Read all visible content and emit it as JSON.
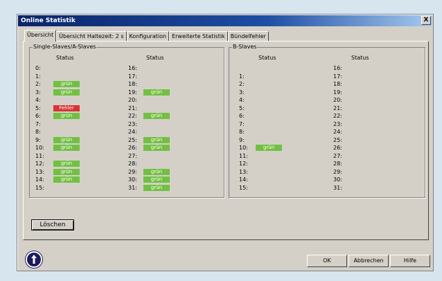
{
  "window": {
    "title": "Online Statistik",
    "close_label": "X"
  },
  "tabs": [
    "Übersicht",
    "Übersicht  Haltezeit: 2 s",
    "Konfiguration",
    "Erweiterte Statistik",
    "Bündelfehler"
  ],
  "single_group": {
    "title": "Single-Slaves/A-Slaves",
    "status_header": "Status",
    "left": [
      {
        "num": "0:",
        "status": ""
      },
      {
        "num": "1:",
        "status": ""
      },
      {
        "num": "2:",
        "status": "grün"
      },
      {
        "num": "3:",
        "status": "grün"
      },
      {
        "num": "4:",
        "status": ""
      },
      {
        "num": "5:",
        "status": "Fehler"
      },
      {
        "num": "6:",
        "status": "grün"
      },
      {
        "num": "7:",
        "status": ""
      },
      {
        "num": "8:",
        "status": ""
      },
      {
        "num": "9:",
        "status": "grün"
      },
      {
        "num": "10:",
        "status": "grün"
      },
      {
        "num": "11:",
        "status": ""
      },
      {
        "num": "12:",
        "status": "grün"
      },
      {
        "num": "13:",
        "status": "grün"
      },
      {
        "num": "14:",
        "status": "grün"
      },
      {
        "num": "15:",
        "status": ""
      }
    ],
    "right": [
      {
        "num": "16:",
        "status": ""
      },
      {
        "num": "17:",
        "status": ""
      },
      {
        "num": "18:",
        "status": ""
      },
      {
        "num": "19:",
        "status": "grün"
      },
      {
        "num": "20:",
        "status": ""
      },
      {
        "num": "21:",
        "status": ""
      },
      {
        "num": "22:",
        "status": "grün"
      },
      {
        "num": "23:",
        "status": ""
      },
      {
        "num": "24:",
        "status": ""
      },
      {
        "num": "25:",
        "status": "grün"
      },
      {
        "num": "26:",
        "status": "grün"
      },
      {
        "num": "27:",
        "status": ""
      },
      {
        "num": "28:",
        "status": ""
      },
      {
        "num": "29:",
        "status": "grün"
      },
      {
        "num": "30:",
        "status": "grün"
      },
      {
        "num": "31:",
        "status": "grün"
      }
    ]
  },
  "b_group": {
    "title": "B-Slaves",
    "status_header": "Status",
    "left": [
      {
        "num": "",
        "status": ""
      },
      {
        "num": "1:",
        "status": ""
      },
      {
        "num": "2:",
        "status": ""
      },
      {
        "num": "3:",
        "status": ""
      },
      {
        "num": "4:",
        "status": ""
      },
      {
        "num": "5:",
        "status": ""
      },
      {
        "num": "6:",
        "status": ""
      },
      {
        "num": "7:",
        "status": ""
      },
      {
        "num": "8:",
        "status": ""
      },
      {
        "num": "9:",
        "status": ""
      },
      {
        "num": "10:",
        "status": "grün"
      },
      {
        "num": "11:",
        "status": ""
      },
      {
        "num": "12:",
        "status": ""
      },
      {
        "num": "13:",
        "status": ""
      },
      {
        "num": "14:",
        "status": ""
      },
      {
        "num": "15:",
        "status": ""
      }
    ],
    "right": [
      {
        "num": "16:",
        "status": ""
      },
      {
        "num": "17:",
        "status": ""
      },
      {
        "num": "18:",
        "status": ""
      },
      {
        "num": "19:",
        "status": ""
      },
      {
        "num": "20:",
        "status": ""
      },
      {
        "num": "21:",
        "status": ""
      },
      {
        "num": "22:",
        "status": ""
      },
      {
        "num": "23:",
        "status": ""
      },
      {
        "num": "24:",
        "status": ""
      },
      {
        "num": "25:",
        "status": ""
      },
      {
        "num": "26:",
        "status": ""
      },
      {
        "num": "27:",
        "status": ""
      },
      {
        "num": "28:",
        "status": ""
      },
      {
        "num": "29:",
        "status": ""
      },
      {
        "num": "30:",
        "status": ""
      },
      {
        "num": "31:",
        "status": ""
      }
    ]
  },
  "buttons": {
    "clear": "Löschen",
    "ok": "OK",
    "cancel": "Abbrechen",
    "help": "Hilfe"
  },
  "colors": {
    "ok_status": "#72c042",
    "error_status": "#d63434"
  },
  "icons": {
    "info": "info-icon"
  }
}
